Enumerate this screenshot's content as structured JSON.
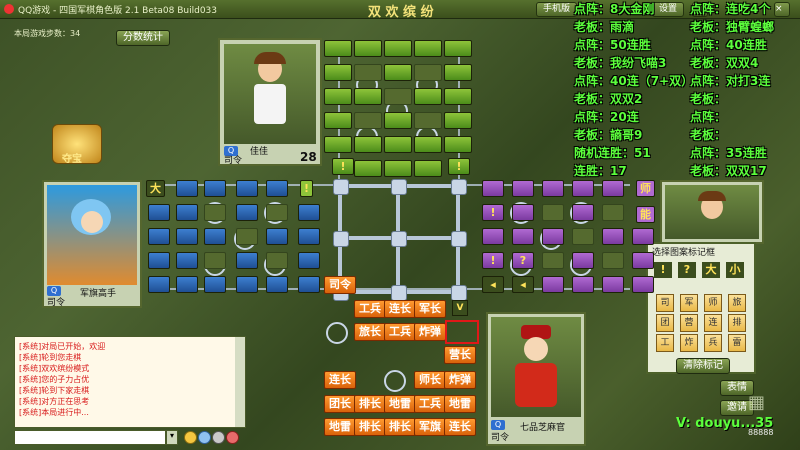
{
  "titlebar": {
    "title": "QQ游戏 - 四国军棋角色版 2.1 Beta08 Build033",
    "mode": "双 欢 缤 纷",
    "btn_hand": "手机版",
    "btn_settings": "设置"
  },
  "steps_label": "本局游戏步数：34",
  "btn_score": "分数统计",
  "treasure": "夺宝",
  "players": {
    "top": {
      "name": "佳佳",
      "rank": "司令",
      "count": "28"
    },
    "left": {
      "name": "军旗高手",
      "rank": "司令"
    },
    "bottom": {
      "name": "七品芝麻官",
      "rank": "司令"
    }
  },
  "overlay_left": [
    "点阵：8大金刚",
    "老板：雨滴",
    "点阵：50连胜",
    "老板：我纷飞喵3",
    "点阵：40连（7+双）",
    "老板：双双2",
    "点阵：20连",
    "老板：謪哥9",
    "随机连胜：51",
    "连胜：17"
  ],
  "overlay_right": [
    "点阵：连吃4个",
    "老板：独臂蝗螂",
    "点阵：40连胜",
    "老板：双双4",
    "点阵：对打3连",
    "老板：",
    "点阵：",
    "老板：",
    "点阵：35连胜",
    "老板：双双17"
  ],
  "board": {
    "left_labels": [
      "大",
      "!"
    ],
    "right_labels": [
      "师",
      "能"
    ],
    "purple_marks": [
      "!",
      "?",
      "!"
    ],
    "green_marks": [
      "!",
      "!"
    ],
    "misc_label": "司令",
    "pieces_row1": [
      "工兵",
      "连长",
      "军长"
    ],
    "pieces_row2": [
      "旅长",
      "工兵",
      "炸弹"
    ],
    "piece_single": "营长",
    "pieces_row3": [
      "连长",
      "师长",
      "炸弹"
    ],
    "pieces_row4": [
      "团长",
      "排长",
      "地雷",
      "工兵",
      "地雷"
    ],
    "pieces_row5": [
      "地雷",
      "排长",
      "排长",
      "军旗",
      "连长"
    ],
    "arrow": "V"
  },
  "mark_panel": {
    "title": "选择图案标记框",
    "top": [
      "!",
      "?",
      "大",
      "小"
    ],
    "grid": [
      "司",
      "军",
      "师",
      "旅",
      "团",
      "营",
      "连",
      "排",
      "工",
      "炸",
      "兵",
      "雷"
    ],
    "clear": "清除标记"
  },
  "chat_lines": [
    "[系统]对局已开始，欢迎",
    "[系统]轮到您走棋",
    "[系统]双欢缤纷模式",
    "[系统]您的子力占优",
    "[系统]轮到下家走棋",
    "[系统]对方正在思考",
    "[系统]本局进行中..."
  ],
  "btn_emote": "表情",
  "btn_invite": "邀请",
  "watermark": "V: douyu...35",
  "spectators": "88888"
}
